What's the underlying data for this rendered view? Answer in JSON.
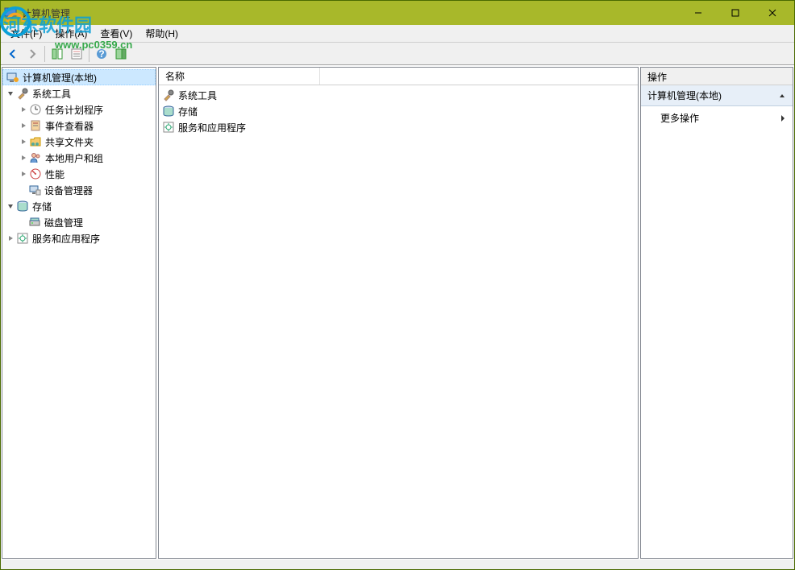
{
  "title": "计算机管理",
  "watermark_text": "河东软件园",
  "watermark_url": "www.pc0359.cn",
  "window_controls": {
    "minimize": "minimize",
    "maximize": "maximize",
    "close": "close"
  },
  "menu": {
    "file": "文件(F)",
    "action": "操作(A)",
    "view": "查看(V)",
    "help": "帮助(H)"
  },
  "tree": {
    "root": "计算机管理(本地)",
    "system_tools": "系统工具",
    "task_scheduler": "任务计划程序",
    "event_viewer": "事件查看器",
    "shared_folders": "共享文件夹",
    "local_users": "本地用户和组",
    "performance": "性能",
    "device_manager": "设备管理器",
    "storage": "存储",
    "disk_mgmt": "磁盘管理",
    "services_apps": "服务和应用程序"
  },
  "list": {
    "header_name": "名称",
    "rows": [
      {
        "icon": "tools",
        "label": "系统工具"
      },
      {
        "icon": "storage",
        "label": "存储"
      },
      {
        "icon": "services",
        "label": "服务和应用程序"
      }
    ]
  },
  "actions": {
    "header": "操作",
    "section": "计算机管理(本地)",
    "more": "更多操作"
  }
}
